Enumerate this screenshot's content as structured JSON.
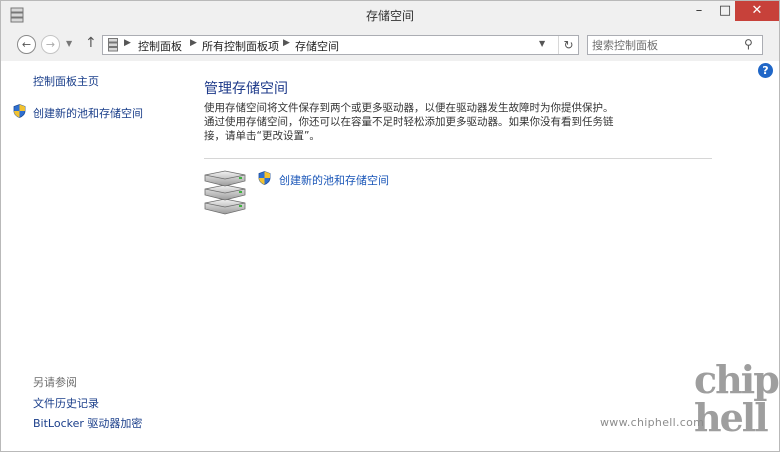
{
  "window": {
    "title": "存储空间"
  },
  "address_bar": {
    "crumbs": [
      "控制面板",
      "所有控制面板项",
      "存储空间"
    ]
  },
  "search": {
    "placeholder": "搜索控制面板"
  },
  "sidebar": {
    "home_link": "控制面板主页",
    "create_link": "创建新的池和存储空间",
    "see_also_label": "另请参阅",
    "see_also_links": [
      "文件历史记录",
      "BitLocker 驱动器加密"
    ]
  },
  "main": {
    "title": "管理存储空间",
    "description_lines": [
      "使用存储空间将文件保存到两个或更多驱动器，以便在驱动器发生故障时为你提供保护。",
      "通过使用存储空间，你还可以在容量不足时轻松添加更多驱动器。如果你没有看到任务链",
      "接，请单击“更改设置”。"
    ],
    "create_link": "创建新的池和存储空间"
  },
  "watermark": {
    "url": "www.chiphell.com",
    "logo": "chip hell"
  },
  "colors": {
    "link": "#1a56b8",
    "title": "#1e3a8a",
    "close": "#c7413a"
  },
  "icons": [
    "storage-spaces-icon",
    "back-arrow-icon",
    "forward-arrow-icon",
    "recent-dropdown-icon",
    "up-arrow-icon",
    "refresh-icon",
    "search-icon",
    "help-icon",
    "uac-shield-icon",
    "drive-stack-icon"
  ]
}
